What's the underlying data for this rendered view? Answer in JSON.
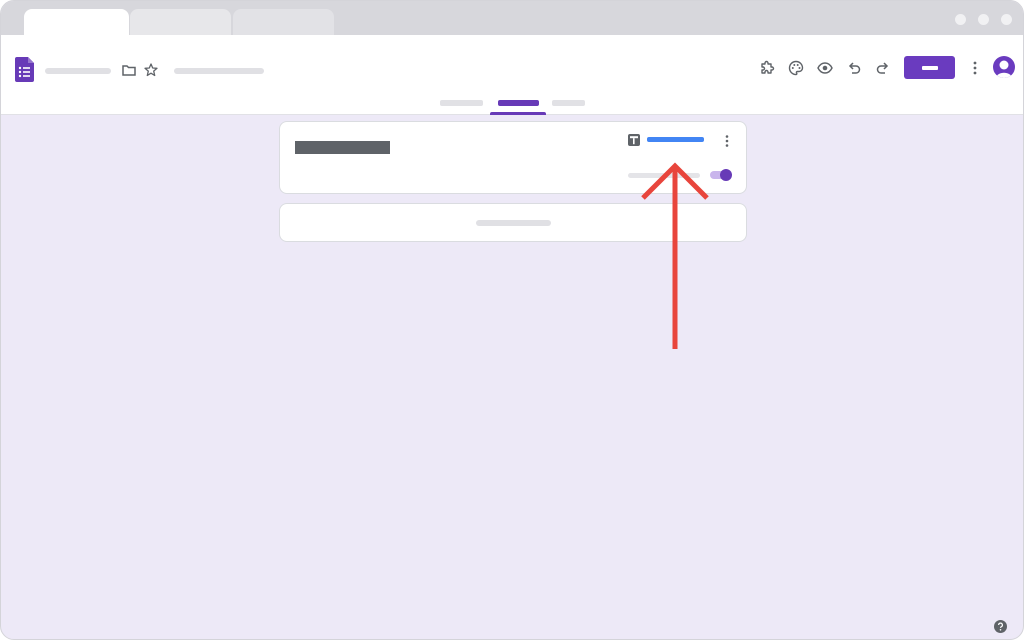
{
  "browser": {
    "tabs": [
      {
        "label": "",
        "active": true
      },
      {
        "label": "",
        "active": false
      },
      {
        "label": "",
        "active": false
      }
    ],
    "window_controls": [
      "minimize",
      "maximize",
      "close"
    ]
  },
  "header": {
    "app_icon": "google-forms-icon",
    "form_title": "",
    "saved_status": "",
    "toolbar_icons": [
      "addon-icon",
      "palette-icon",
      "eye-icon",
      "undo-icon",
      "redo-icon",
      "more-vert-icon"
    ],
    "send_label": "",
    "avatar": "user-avatar"
  },
  "tabs": {
    "items": [
      {
        "label": "",
        "selected": false
      },
      {
        "label": "",
        "selected": true
      },
      {
        "label": "",
        "selected": false
      }
    ]
  },
  "responses": {
    "title": "",
    "sheets_link_label": "",
    "accepting_label": "",
    "accepting_on": true,
    "empty_message": ""
  },
  "annotation": {
    "arrow_color": "#e8453c",
    "points_to": "sheets-link"
  },
  "colors": {
    "brand": "#673ab7",
    "background": "#ede9f7",
    "link": "#4285f4",
    "annotation": "#e8453c"
  },
  "help_icon": "help-icon"
}
